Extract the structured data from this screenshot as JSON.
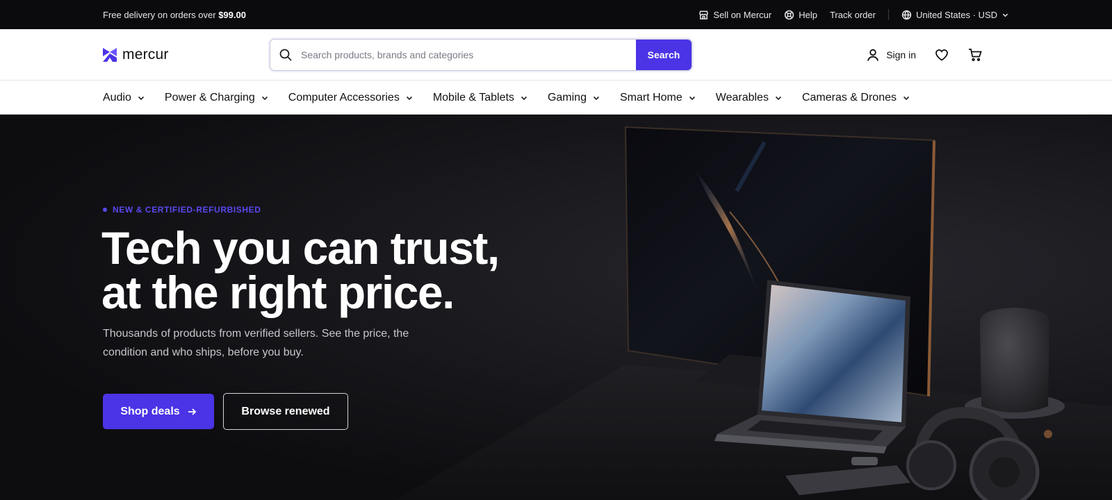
{
  "topbar": {
    "promo_text": "Free delivery on orders over ",
    "promo_amount": "$99.00",
    "links": [
      {
        "label": "Sell on Mercur",
        "icon": "store-icon"
      },
      {
        "label": "Help",
        "icon": "help-icon"
      },
      {
        "label": "Track order",
        "icon": ""
      }
    ],
    "locale": {
      "label": "United States · USD",
      "icon": "globe-icon"
    }
  },
  "header": {
    "logo_text": "mercur",
    "search": {
      "placeholder": "Search products, brands and categories",
      "value": "",
      "button_label": "Search"
    },
    "signin_label": "Sign in",
    "icons": [
      "user-icon",
      "heart-icon",
      "cart-icon"
    ]
  },
  "categories": [
    "Audio",
    "Power & Charging",
    "Computer Accessories",
    "Mobile & Tablets",
    "Gaming",
    "Smart Home",
    "Wearables",
    "Cameras & Drones"
  ],
  "hero": {
    "badge": "NEW & CERTIFIED-REFURBISHED",
    "title_line1": "Tech you can trust,",
    "title_line2": "at the right price.",
    "subtitle": "Thousands of products from verified sellers. See the price, the condition and who ships, before you buy.",
    "primary_button": "Shop deals",
    "secondary_button": "Browse renewed"
  },
  "colors": {
    "accent": "#4a34e6",
    "topbar_bg": "#0b0b0e",
    "hero_bg": "#131317"
  }
}
